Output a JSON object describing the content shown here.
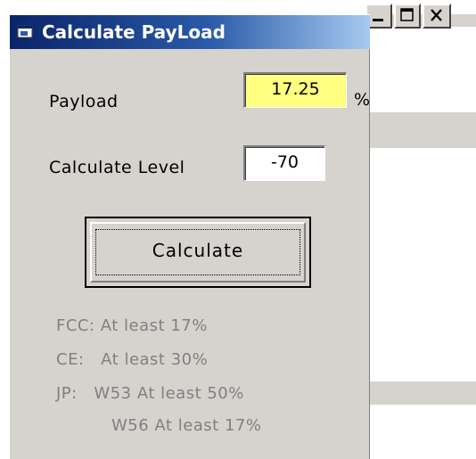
{
  "window": {
    "title": "Calculate PayLoad"
  },
  "form": {
    "payload_label": "Payload",
    "payload_value": "17.25",
    "payload_unit": "%",
    "level_label": "Calculate Level",
    "level_value": "-70",
    "calculate_button": "Calculate"
  },
  "info": {
    "fcc": "FCC: At least 17%",
    "ce": "CE:   At least 30%",
    "jp_w53": "JP:   W53 At least 50%",
    "jp_w56": "W56 At least 17%"
  },
  "colors": {
    "payload_field_bg": "#ffff80",
    "window_face": "#d6d3ce",
    "titlebar_start": "#0a246a",
    "info_text": "#808080"
  }
}
